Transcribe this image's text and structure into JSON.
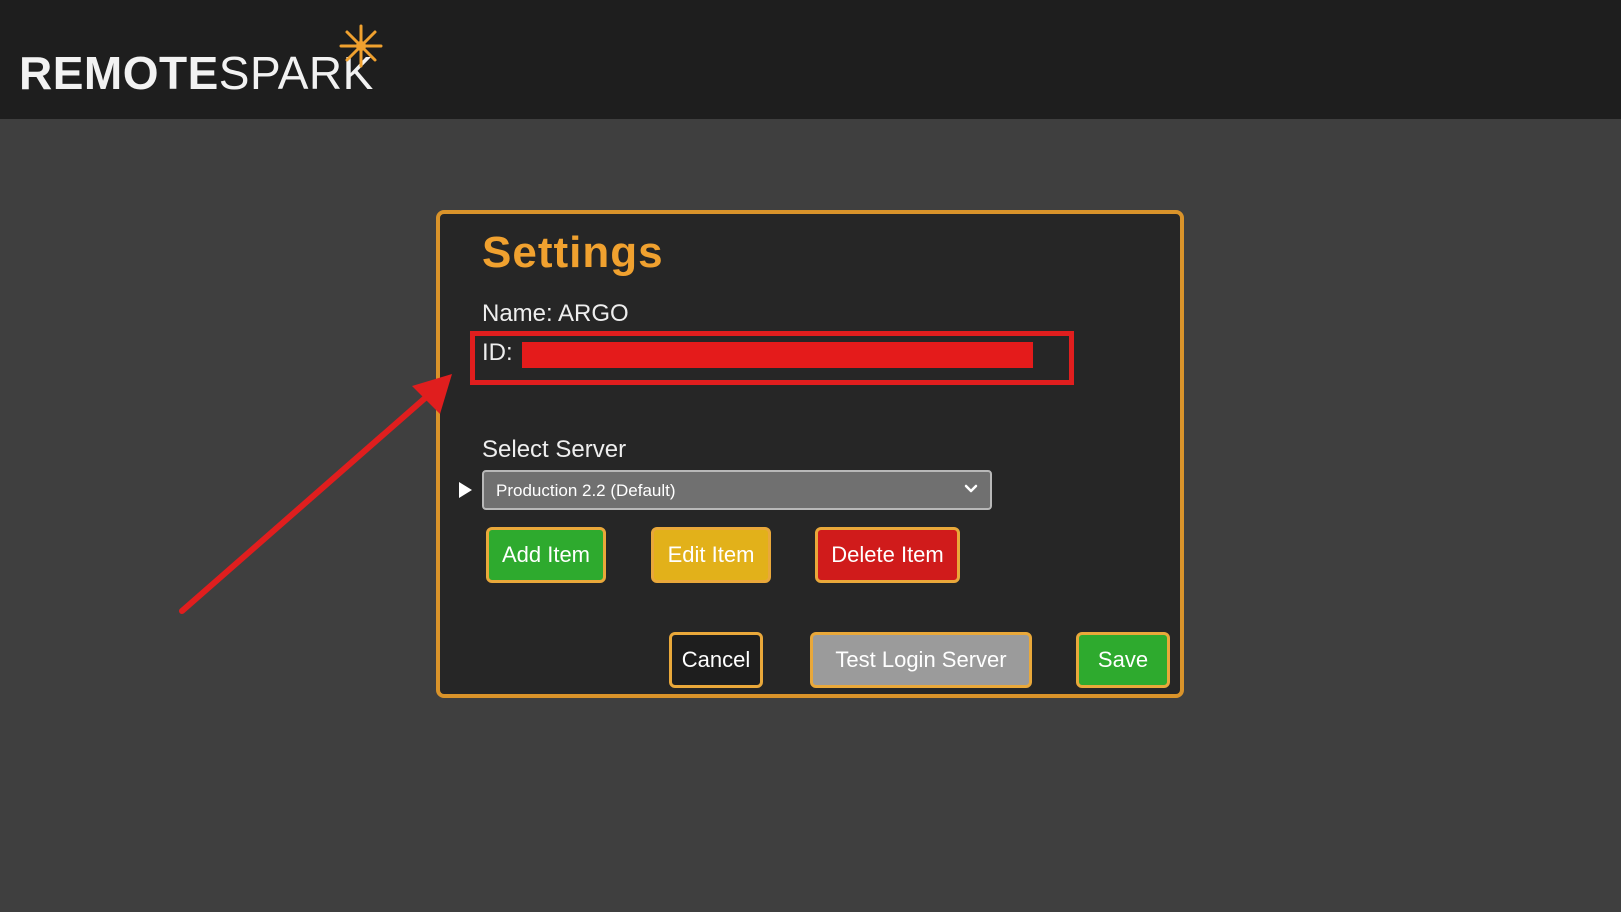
{
  "header": {
    "logo_part1": "REMOTE",
    "logo_part2": "SPARK",
    "logo_accent_color": "#f0a12f"
  },
  "dialog": {
    "title": "Settings",
    "name_label": "Name: ARGO",
    "id_label": "ID:",
    "select_server_label": "Select Server",
    "server_select_value": "Production 2.2 (Default)",
    "buttons": {
      "add": "Add Item",
      "edit": "Edit Item",
      "delete": "Delete Item",
      "cancel": "Cancel",
      "test": "Test Login Server",
      "save": "Save"
    }
  },
  "colors": {
    "dialog_border": "#d9932a",
    "title": "#f0a12f",
    "annotation_red": "#e01e1e",
    "green": "#2eaa2e",
    "yellow": "#e2b11a",
    "red": "#d01b1b",
    "gray": "#9b9b9b"
  },
  "icons": [
    "spark-icon",
    "play-icon",
    "chevron-down-icon",
    "annotation-arrow"
  ]
}
